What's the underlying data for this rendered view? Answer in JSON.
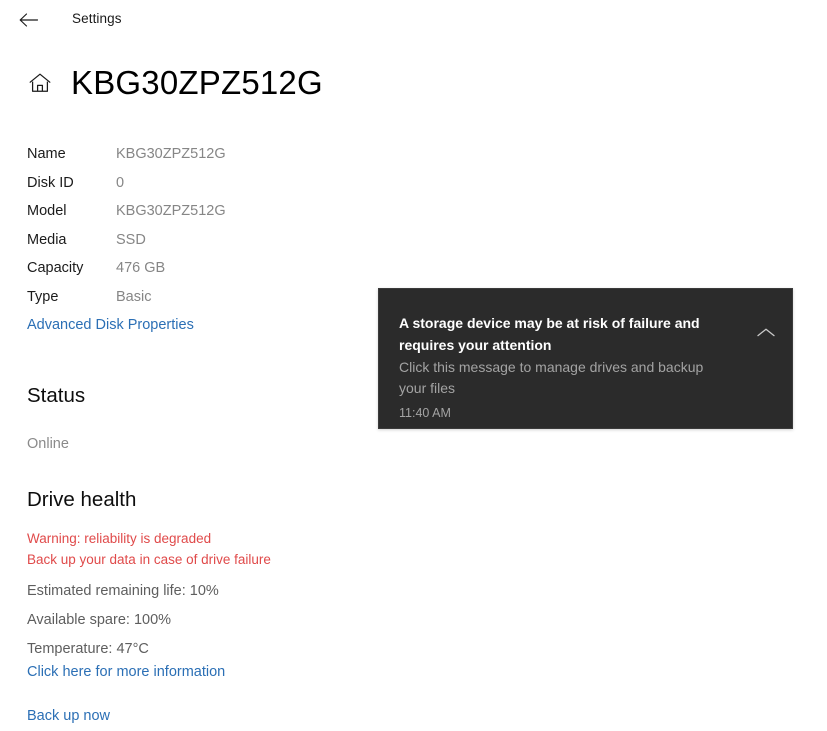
{
  "titlebar": {
    "back_icon": "back-arrow-icon",
    "label": "Settings"
  },
  "header": {
    "home_icon": "home-icon",
    "title": "KBG30ZPZ512G"
  },
  "properties": {
    "rows": [
      {
        "label": "Name",
        "value": "KBG30ZPZ512G"
      },
      {
        "label": "Disk ID",
        "value": "0"
      },
      {
        "label": "Model",
        "value": "KBG30ZPZ512G"
      },
      {
        "label": "Media",
        "value": "SSD"
      },
      {
        "label": "Capacity",
        "value": "476 GB"
      },
      {
        "label": "Type",
        "value": "Basic"
      }
    ],
    "advanced_link": "Advanced Disk Properties"
  },
  "status": {
    "heading": "Status",
    "value": "Online"
  },
  "drive_health": {
    "heading": "Drive health",
    "warning_line1": "Warning: reliability is degraded",
    "warning_line2": "Back up your data in case of drive failure",
    "metrics": [
      "Estimated remaining life: 10%",
      "Available spare: 100%",
      "Temperature: 47°C"
    ],
    "info_link": "Click here for more information",
    "backup_link": "Back up now"
  },
  "notification": {
    "title_line1": "A storage device may be at risk of failure and",
    "title_line2": "requires your attention",
    "body_line1": "Click this message to manage drives and backup",
    "body_line2": "your files",
    "time": "11:40 AM",
    "collapse_icon": "chevron-up-icon"
  },
  "colors": {
    "link": "#2b6fb5",
    "warning": "#e04a4a",
    "value_text": "#868686",
    "toast_background": "#2b2b2b",
    "page_background": "#ffffff"
  }
}
